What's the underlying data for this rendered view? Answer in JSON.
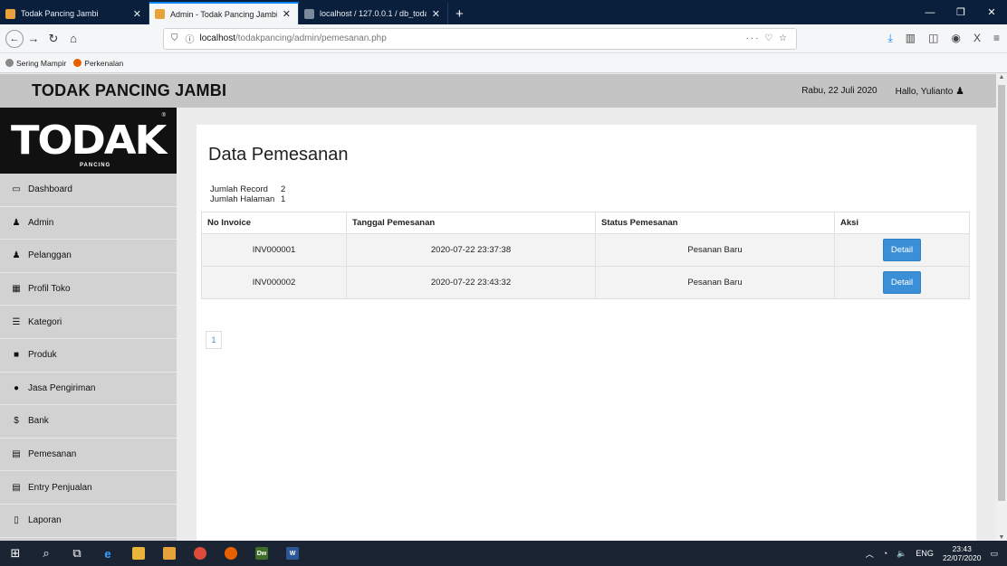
{
  "browser": {
    "tabs": [
      {
        "title": "Todak Pancing Jambi",
        "active": false,
        "favicon_color": "#e8a23a"
      },
      {
        "title": "Admin - Todak Pancing Jambi",
        "active": true,
        "favicon_color": "#e8a23a"
      },
      {
        "title": "localhost / 127.0.0.1 / db_todak",
        "active": false,
        "favicon_color": "#7a8a9a"
      }
    ],
    "url_host": "localhost",
    "url_path": "/todakpancing/admin/pemesanan.php",
    "bookmarks": [
      "Sering Mampir",
      "Perkenalan"
    ]
  },
  "header": {
    "brand": "TODAK PANCING JAMBI",
    "date": "Rabu, 22 Juli 2020",
    "greeting": "Hallo, Yulianto"
  },
  "logo": {
    "main": "TODAK",
    "sub": "PANCING"
  },
  "sidebar": {
    "items": [
      {
        "label": "Dashboard",
        "icon": "monitor-icon"
      },
      {
        "label": "Admin",
        "icon": "user-icon"
      },
      {
        "label": "Pelanggan",
        "icon": "users-icon"
      },
      {
        "label": "Profil Toko",
        "icon": "table-icon"
      },
      {
        "label": "Kategori",
        "icon": "list-icon"
      },
      {
        "label": "Produk",
        "icon": "box-icon"
      },
      {
        "label": "Jasa Pengiriman",
        "icon": "map-marker-icon"
      },
      {
        "label": "Bank",
        "icon": "dollar-icon"
      },
      {
        "label": "Pemesanan",
        "icon": "card-icon"
      },
      {
        "label": "Entry Penjualan",
        "icon": "card-icon"
      },
      {
        "label": "Laporan",
        "icon": "file-icon"
      }
    ]
  },
  "main": {
    "title": "Data Pemesanan",
    "stats": {
      "jumlah_record_label": "Jumlah Record",
      "jumlah_record_value": "2",
      "jumlah_halaman_label": "Jumlah Halaman",
      "jumlah_halaman_value": "1"
    },
    "table": {
      "headers": [
        "No Invoice",
        "Tanggal Pemesanan",
        "Status Pemesanan",
        "Aksi"
      ],
      "rows": [
        {
          "invoice": "INV000001",
          "tanggal": "2020-07-22 23:37:38",
          "status": "Pesanan Baru",
          "action": "Detail"
        },
        {
          "invoice": "INV000002",
          "tanggal": "2020-07-22 23:43:32",
          "status": "Pesanan Baru",
          "action": "Detail"
        }
      ]
    },
    "pagination": [
      "1"
    ]
  },
  "taskbar": {
    "lang": "ENG",
    "time": "23:43",
    "date": "22/07/2020"
  }
}
